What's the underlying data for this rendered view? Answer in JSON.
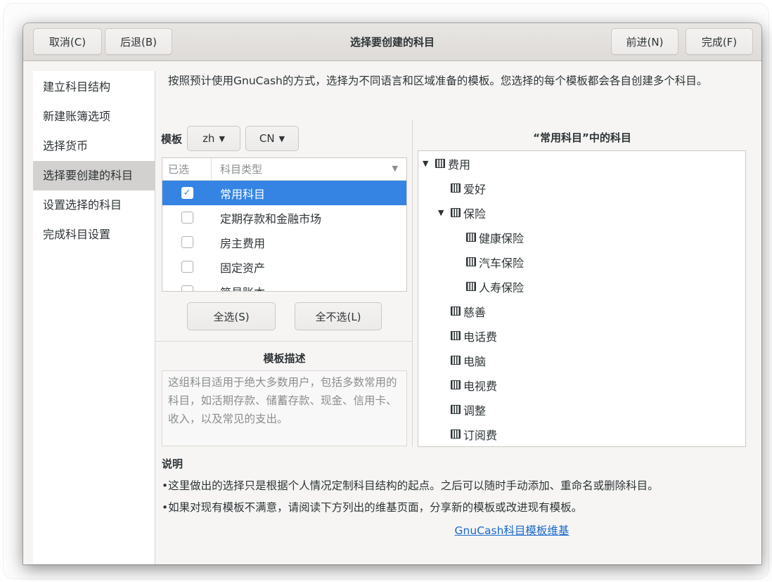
{
  "header": {
    "title": "选择要创建的科目",
    "cancel_label": "取消(C)",
    "back_label": "后退(B)",
    "forward_label": "前进(N)",
    "finish_label": "完成(F)"
  },
  "sidebar": {
    "items": [
      {
        "label": "建立科目结构"
      },
      {
        "label": "新建账簿选项"
      },
      {
        "label": "选择货币"
      },
      {
        "label": "选择要创建的科目"
      },
      {
        "label": "设置选择的科目"
      },
      {
        "label": "完成科目设置"
      }
    ]
  },
  "intro": "按照预计使用GnuCash的方式，选择为不同语言和区域准备的模板。您选择的每个模板都会各自创建多个科目。",
  "templates": {
    "label": "模板",
    "language": "zh",
    "region": "CN",
    "col_selected": "已选",
    "col_type": "科目类型",
    "rows": [
      {
        "label": "常用科目",
        "checked": true
      },
      {
        "label": "定期存款和金融市场",
        "checked": false
      },
      {
        "label": "房主费用",
        "checked": false
      },
      {
        "label": "固定资产",
        "checked": false
      },
      {
        "label": "简易账本",
        "checked": false
      }
    ],
    "select_all": "全选(S)",
    "select_none": "全不选(L)"
  },
  "description": {
    "title": "模板描述",
    "text": "这组科目适用于绝大多数用户，包括多数常用的科目，如活期存款、储蓄存款、现金、信用卡、收入，以及常见的支出。"
  },
  "tree": {
    "title": "“常用科目”中的科目",
    "items": [
      {
        "label": "费用",
        "level": 0,
        "expander": "▼"
      },
      {
        "label": "爱好",
        "level": 1,
        "expander": ""
      },
      {
        "label": "保险",
        "level": 1,
        "expander": "▼"
      },
      {
        "label": "健康保险",
        "level": 2,
        "expander": ""
      },
      {
        "label": "汽车保险",
        "level": 2,
        "expander": ""
      },
      {
        "label": "人寿保险",
        "level": 2,
        "expander": ""
      },
      {
        "label": "慈善",
        "level": 1,
        "expander": ""
      },
      {
        "label": "电话费",
        "level": 1,
        "expander": ""
      },
      {
        "label": "电脑",
        "level": 1,
        "expander": ""
      },
      {
        "label": "电视费",
        "level": 1,
        "expander": ""
      },
      {
        "label": "调整",
        "level": 1,
        "expander": ""
      },
      {
        "label": "订阅费",
        "level": 1,
        "expander": ""
      }
    ]
  },
  "notes": {
    "title": "说明",
    "line1": "•这里做出的选择只是根据个人情况定制科目结构的起点。之后可以随时手动添加、重命名或删除科目。",
    "line2": "•如果对现有模板不满意，请阅读下方列出的维基页面，分享新的模板或改进现有模板。",
    "link": "GnuCash科目模板维基"
  },
  "colors": {
    "selection": "#3584e4",
    "link": "#1b6acb"
  }
}
